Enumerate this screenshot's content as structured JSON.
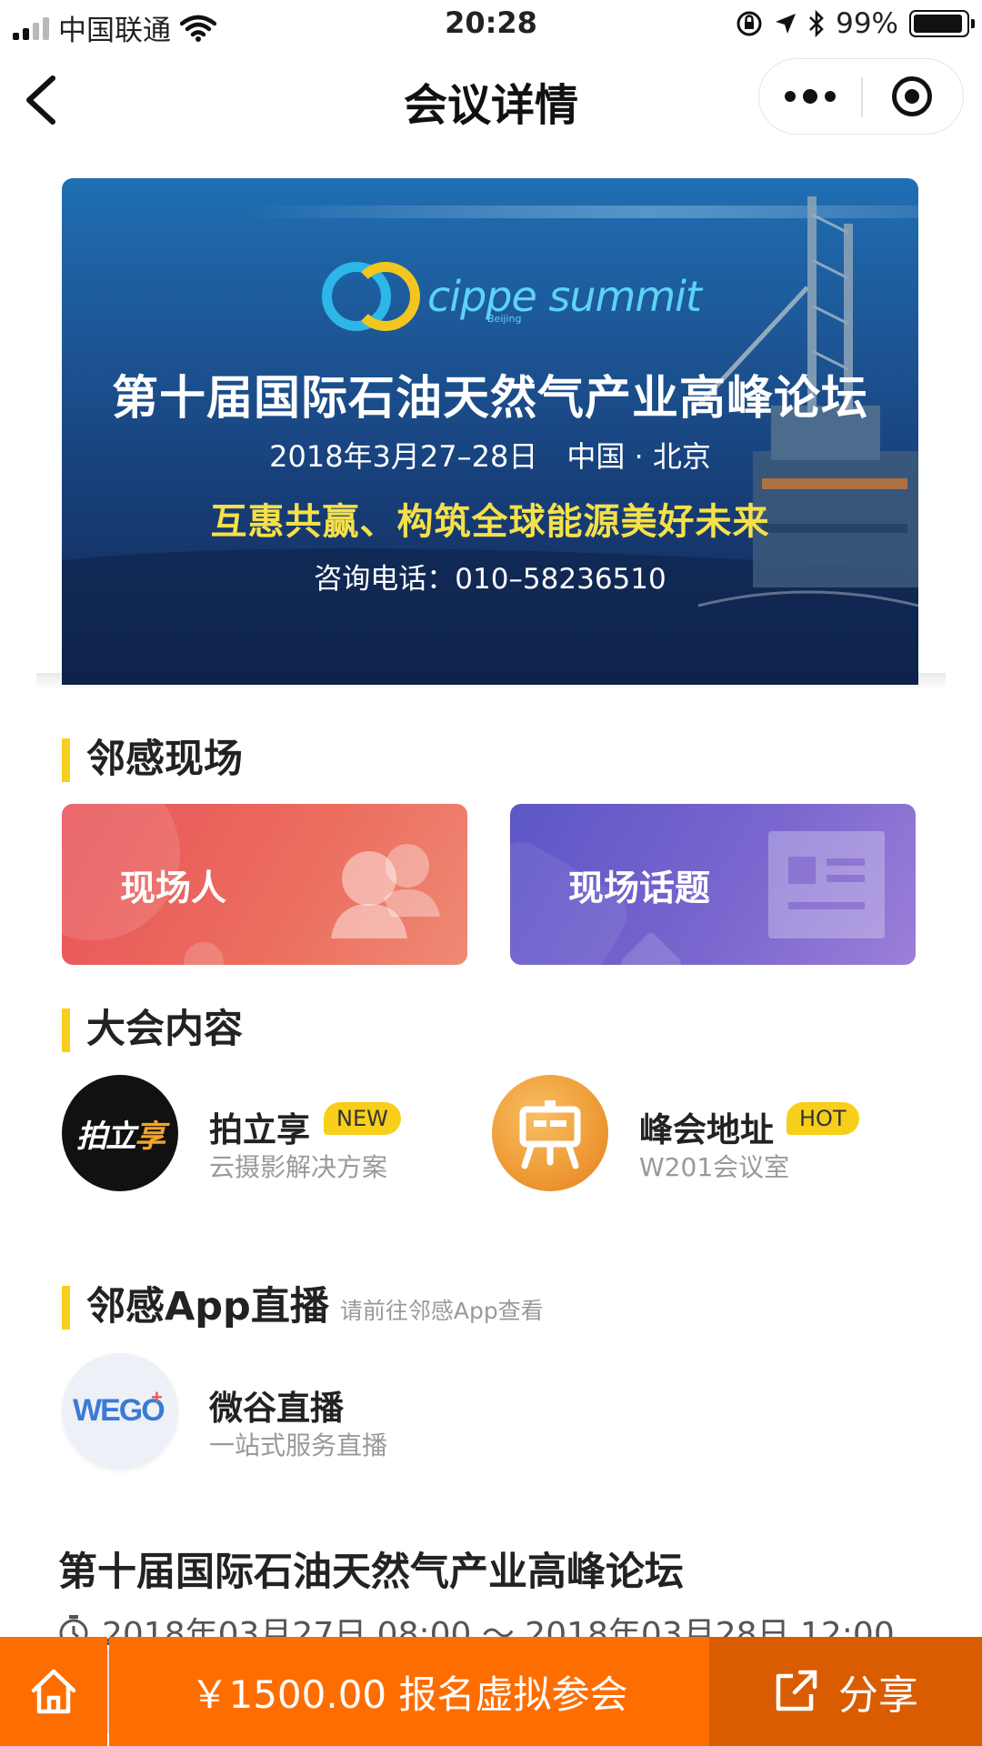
{
  "status_bar": {
    "carrier": "中国联通",
    "time": "20:28",
    "battery_percent": "99%",
    "battery_level": 0.99
  },
  "nav": {
    "title": "会议详情"
  },
  "banner": {
    "logo_text": "cippe summit",
    "logo_sub": "Beijing",
    "title": "第十届国际石油天然气产业高峰论坛",
    "date_line": "2018年3月27–28日　中国 · 北京",
    "slogan": "互惠共赢、构筑全球能源美好未来",
    "phone": "咨询电话：010–58236510"
  },
  "section_onsite": {
    "title": "邻感现场",
    "cards": [
      {
        "label": "现场人"
      },
      {
        "label": "现场话题"
      }
    ]
  },
  "section_content": {
    "title": "大会内容",
    "items": [
      {
        "avatar_text_a": "拍立",
        "avatar_text_b": "享",
        "name": "拍立享",
        "badge": "NEW",
        "subtitle": "云摄影解决方案"
      },
      {
        "name": "峰会地址",
        "badge": "HOT",
        "subtitle": "W201会议室"
      }
    ]
  },
  "section_live": {
    "title": "邻感App直播",
    "hint": "请前往邻感App查看",
    "items": [
      {
        "avatar_text": "WEGO",
        "name": "微谷直播",
        "subtitle": "一站式服务直播"
      }
    ]
  },
  "event": {
    "title": "第十届国际石油天然气产业高峰论坛",
    "time_range": "2018年03月27日 08:00 ～ 2018年03月28日 12:00"
  },
  "bottom_bar": {
    "signup_label": "￥1500.00 报名虚拟参会",
    "share_label": "分享"
  },
  "colors": {
    "accent_orange": "#fe6d00",
    "share_orange": "#d95c00",
    "section_bar_yellow": "#f7cf1b",
    "card_red": "#e8535a",
    "card_purple": "#6d5fcb"
  },
  "icons": [
    "signal-icon",
    "wifi-icon",
    "rotation-lock-icon",
    "location-arrow-icon",
    "bluetooth-icon",
    "battery-icon",
    "back-chevron-icon",
    "more-dots-icon",
    "target-close-icon",
    "person-icon",
    "article-icon",
    "easel-icon",
    "clock-icon",
    "home-icon",
    "share-icon"
  ]
}
